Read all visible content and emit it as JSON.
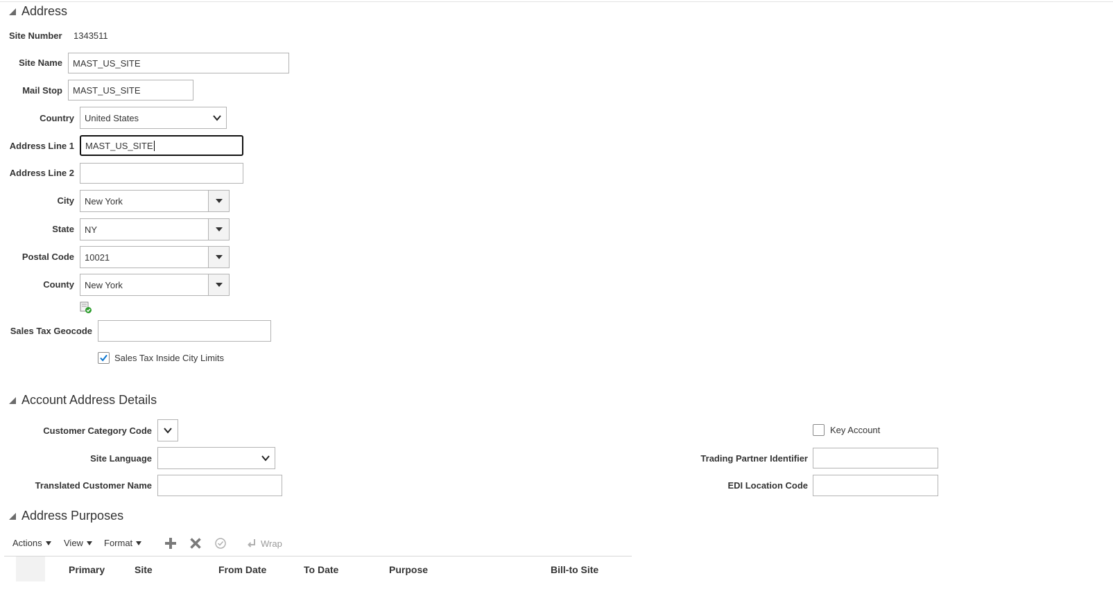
{
  "address": {
    "title": "Address",
    "site_number_label": "Site Number",
    "site_number": "1343511",
    "site_name_label": "Site Name",
    "site_name": "MAST_US_SITE",
    "mail_stop_label": "Mail Stop",
    "mail_stop": "MAST_US_SITE",
    "country_label": "Country",
    "country": "United States",
    "address_line1_label": "Address Line 1",
    "address_line1": "MAST_US_SITE",
    "address_line2_label": "Address Line 2",
    "address_line2": "",
    "city_label": "City",
    "city": "New York",
    "state_label": "State",
    "state": "NY",
    "postal_code_label": "Postal Code",
    "postal_code": "10021",
    "county_label": "County",
    "county": "New York",
    "sales_tax_geocode_label": "Sales Tax Geocode",
    "sales_tax_geocode": "",
    "sales_tax_inside_city_limits_label": "Sales Tax Inside City Limits",
    "sales_tax_inside_city_limits": true
  },
  "account_details": {
    "title": "Account Address Details",
    "customer_category_code_label": "Customer Category Code",
    "site_language_label": "Site Language",
    "translated_customer_name_label": "Translated Customer Name",
    "key_account_label": "Key Account",
    "key_account": false,
    "trading_partner_identifier_label": "Trading Partner Identifier",
    "edi_location_code_label": "EDI Location Code"
  },
  "purposes": {
    "title": "Address Purposes",
    "toolbar": {
      "actions": "Actions",
      "view": "View",
      "format": "Format",
      "wrap": "Wrap"
    },
    "columns": [
      "Primary",
      "Site",
      "From Date",
      "To Date",
      "Purpose",
      "Bill-to Site"
    ]
  },
  "colors": {
    "accent": "#0572ce",
    "validate_green": "#2e9e2e",
    "disabled": "#9a9a9a"
  }
}
